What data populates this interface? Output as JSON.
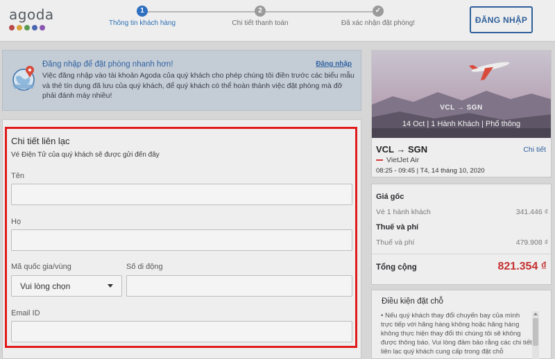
{
  "brand": {
    "name": "agoda",
    "dot_colors": [
      "#c03b3b",
      "#e0a020",
      "#4c9b4c",
      "#3b5fb5",
      "#8e4bb5"
    ]
  },
  "steps": [
    {
      "number": "1",
      "label": "Thông tin khách hàng",
      "state": "active"
    },
    {
      "number": "2",
      "label": "Chi tiết thanh toán",
      "state": "pending"
    },
    {
      "number": "✓",
      "label": "Đã xác nhận đặt phòng!",
      "state": "pending"
    }
  ],
  "header": {
    "login_button": "ĐĂNG NHẬP"
  },
  "banner": {
    "title": "Đăng nhập để đặt phòng nhanh hơn!",
    "link": "Đăng nhập",
    "text": "Việc đăng nhập vào tài khoản Agoda của quý khách cho phép chúng tôi điền trước các biểu mẫu và thẻ tín dụng đã lưu của quý khách, để quý khách có thể hoàn thành việc đặt phòng mà đỡ phải đánh máy nhiều!"
  },
  "contact": {
    "title": "Chi tiết liên lạc",
    "subtitle": "Vé Điện Tử của quý khách sẽ được gửi đến đây",
    "first_name": {
      "label": "Tên",
      "value": ""
    },
    "last_name": {
      "label": "Họ",
      "value": ""
    },
    "country_code": {
      "label": "Mã quốc gia/vùng",
      "selected": "Vui lòng chọn"
    },
    "phone": {
      "label": "Số di động",
      "value": ""
    },
    "email": {
      "label": "Email ID",
      "value": ""
    }
  },
  "flight": {
    "route_overlay": "VCL → SGN",
    "date_overlay": "14 Oct | 1 Hành Khách | Phổ thông",
    "route": "VCL → SGN",
    "details_link": "Chi tiết",
    "airline": "VietJet Air",
    "times": "08:25 - 09:45   |   T4, 14 tháng 10, 2020"
  },
  "pricing": {
    "base_title": "Giá gốc",
    "base_label": "Vé 1 hành khách",
    "base_value": "341.446 ₫",
    "tax_title": "Thuế và phí",
    "tax_label": "Thuế và phí",
    "tax_value": "479.908 ₫",
    "total_label": "Tổng cộng",
    "total_value": "821.354 ₫"
  },
  "conditions": {
    "title": "Điều kiện đặt chỗ",
    "text": "• Nếu quý khách thay đổi chuyến bay của mình trực tiếp với hãng hàng không hoặc hãng hàng không thực hiện thay đổi thì chúng tôi sẽ không được thông báo. Vui lòng đảm bảo rằng các chi tiết liên lạc quý khách cung cấp trong đặt chỗ"
  },
  "colors": {
    "accent": "#2f62a0",
    "highlight_frame": "#e01a1a",
    "total_price": "#c53030"
  }
}
